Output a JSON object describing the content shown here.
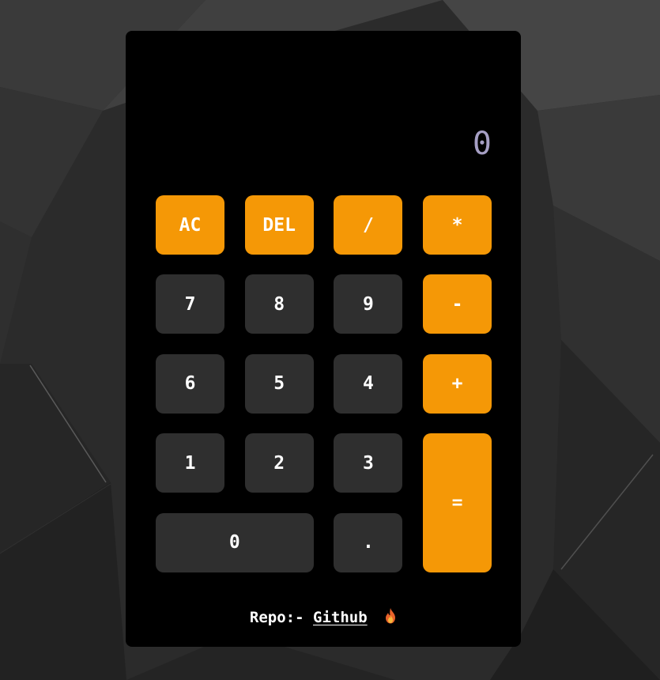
{
  "display": {
    "value": "0"
  },
  "keys": [
    {
      "label": "AC",
      "kind": "op",
      "name": "all-clear-button"
    },
    {
      "label": "DEL",
      "kind": "op",
      "name": "delete-button"
    },
    {
      "label": "/",
      "kind": "op",
      "name": "divide-button"
    },
    {
      "label": "*",
      "kind": "op",
      "name": "multiply-button"
    },
    {
      "label": "7",
      "kind": "num",
      "name": "digit-7-button"
    },
    {
      "label": "8",
      "kind": "num",
      "name": "digit-8-button"
    },
    {
      "label": "9",
      "kind": "num",
      "name": "digit-9-button"
    },
    {
      "label": "-",
      "kind": "op",
      "name": "subtract-button"
    },
    {
      "label": "6",
      "kind": "num",
      "name": "digit-6-button"
    },
    {
      "label": "5",
      "kind": "num",
      "name": "digit-5-button"
    },
    {
      "label": "4",
      "kind": "num",
      "name": "digit-4-button"
    },
    {
      "label": "+",
      "kind": "op",
      "name": "add-button"
    },
    {
      "label": "1",
      "kind": "num",
      "name": "digit-1-button"
    },
    {
      "label": "2",
      "kind": "num",
      "name": "digit-2-button"
    },
    {
      "label": "3",
      "kind": "num",
      "name": "digit-3-button"
    },
    {
      "label": "=",
      "kind": "op",
      "name": "equals-button",
      "extra": "equals"
    },
    {
      "label": "0",
      "kind": "num",
      "name": "digit-0-button",
      "extra": "zero"
    },
    {
      "label": ".",
      "kind": "num",
      "name": "decimal-button"
    }
  ],
  "footer": {
    "prefix": "Repo:-",
    "link_text": "Github",
    "icon": "fire-icon"
  },
  "colors": {
    "operator": "#f59806",
    "number": "#2f2f2f",
    "display_text": "#a69fc4",
    "panel": "#000000"
  }
}
